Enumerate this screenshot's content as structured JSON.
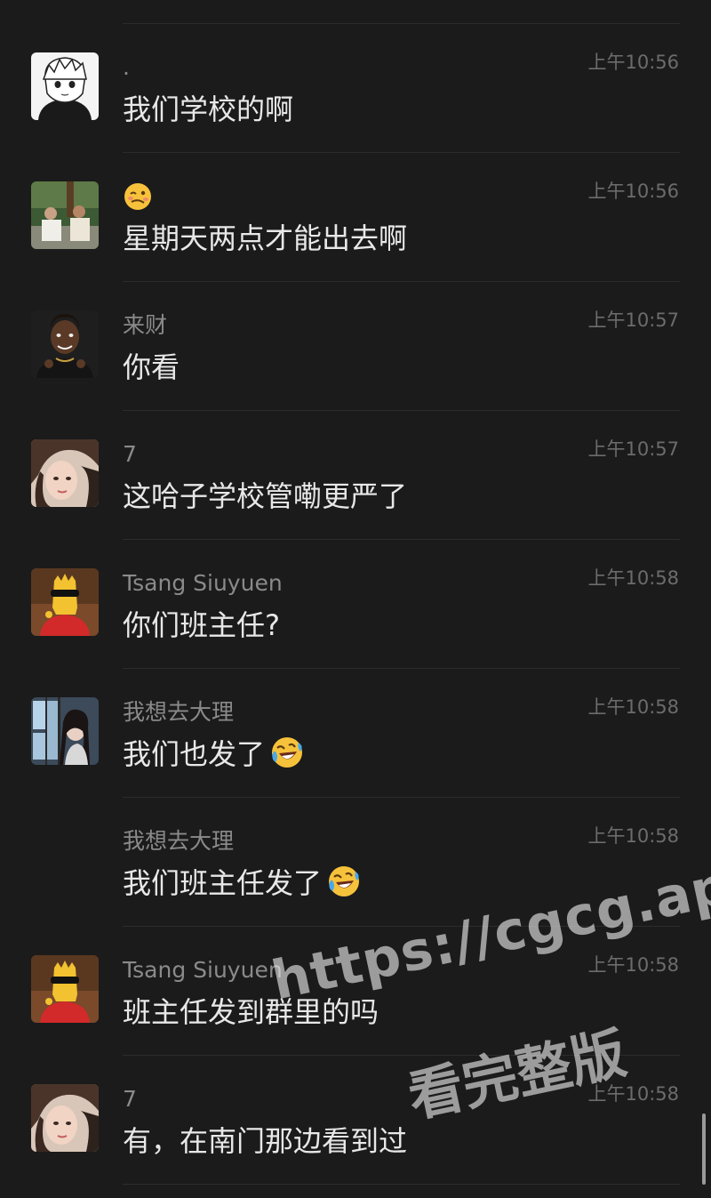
{
  "messages": [
    {
      "avatar": "anime-boy-avatar",
      "sender": ".",
      "sender_is_emoji": false,
      "time": "上午10:56",
      "text": "我们学校的啊",
      "text_emoji": null
    },
    {
      "avatar": "group-photo-avatar",
      "sender": "",
      "sender_is_emoji": true,
      "sender_emoji": "woozy-face-emoji",
      "time": "上午10:56",
      "text": "星期天两点才能出去啊",
      "text_emoji": null
    },
    {
      "avatar": "man-portrait-avatar",
      "sender": "来财",
      "sender_is_emoji": false,
      "time": "上午10:57",
      "text": "你看",
      "text_emoji": null
    },
    {
      "avatar": "girl-selfie-avatar",
      "sender": "7",
      "sender_is_emoji": false,
      "time": "上午10:57",
      "text": "这哈子学校管嘞更严了",
      "text_emoji": null
    },
    {
      "avatar": "bart-sunglasses-avatar",
      "sender": "Tsang Siuyuen",
      "sender_is_emoji": false,
      "time": "上午10:58",
      "text": "你们班主任?",
      "text_emoji": null
    },
    {
      "avatar": "girl-window-avatar",
      "sender": "我想去大理",
      "sender_is_emoji": false,
      "time": "上午10:58",
      "text": "我们也发了",
      "text_emoji": "rolling-laughing-emoji"
    },
    {
      "avatar": null,
      "sender": "我想去大理",
      "sender_is_emoji": false,
      "time": "上午10:58",
      "text": "我们班主任发了",
      "text_emoji": "rolling-laughing-emoji"
    },
    {
      "avatar": "bart-sunglasses-avatar",
      "sender": "Tsang Siuyuen",
      "sender_is_emoji": false,
      "time": "上午10:58",
      "text": "班主任发到群里的吗",
      "text_emoji": null
    },
    {
      "avatar": "girl-selfie-avatar",
      "sender": "7",
      "sender_is_emoji": false,
      "time": "上午10:58",
      "text": "有，在南门那边看到过",
      "text_emoji": null
    }
  ],
  "watermark": {
    "line1": "https://cgcg.app",
    "line2": "看完整版"
  }
}
